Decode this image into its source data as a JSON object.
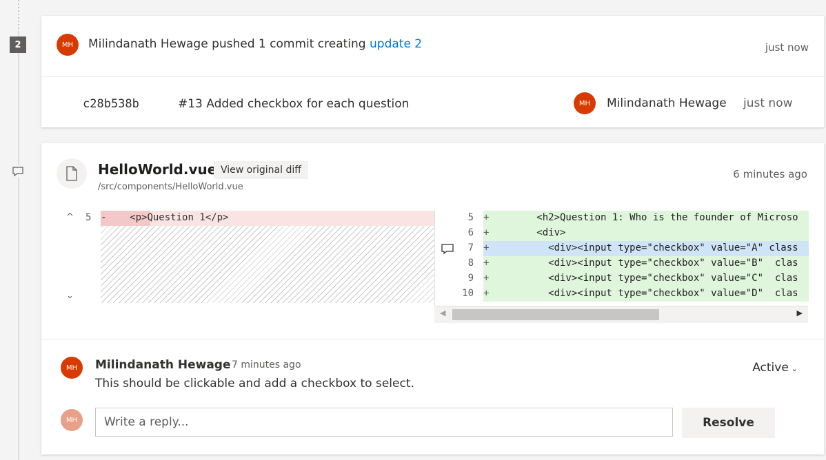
{
  "timeline": {
    "update_number": "2"
  },
  "push_event": {
    "author_initials": "MH",
    "text": "Milindanath Hewage pushed 1 commit creating ",
    "link_text": "update 2",
    "time": "just now"
  },
  "commit": {
    "hash": "c28b538b",
    "message": "#13 Added checkbox for each question",
    "author_initials": "MH",
    "author": "Milindanath Hewage",
    "time": "just now"
  },
  "file": {
    "name": "HelloWorld.vue",
    "view_diff_label": "View original diff",
    "path": "/src/components/HelloWorld.vue",
    "time": "6 minutes ago"
  },
  "diff": {
    "left": {
      "line_number": "5",
      "sign": "-",
      "code": "    <p>Question 1</p>"
    },
    "right": [
      {
        "num": "5",
        "sign": "+",
        "code": "   <h2>Question 1: Who is the founder of Microso"
      },
      {
        "num": "6",
        "sign": "+",
        "code": "   <div>"
      },
      {
        "num": "7",
        "sign": "+",
        "code": "     <div><input type=\"checkbox\" value=\"A\" class"
      },
      {
        "num": "8",
        "sign": "+",
        "code": "     <div><input type=\"checkbox\" value=\"B\"  clas"
      },
      {
        "num": "9",
        "sign": "+",
        "code": "     <div><input type=\"checkbox\" value=\"C\"  clas"
      },
      {
        "num": "10",
        "sign": "+",
        "code": "     <div><input type=\"checkbox\" value=\"D\"  clas"
      }
    ],
    "selected_line": "7"
  },
  "comment": {
    "author_initials": "MH",
    "author": "Milindanath Hewage",
    "time": "7 minutes ago",
    "body": "This should be clickable and add a checkbox to select.",
    "status": "Active"
  },
  "reply": {
    "avatar_initials": "MH",
    "placeholder": "Write a reply...",
    "resolve_label": "Resolve"
  },
  "colors": {
    "accent": "#0078d4",
    "avatar": "#d83b01",
    "added_bg": "#dff6dd",
    "removed_bg": "#f9e3e3"
  }
}
